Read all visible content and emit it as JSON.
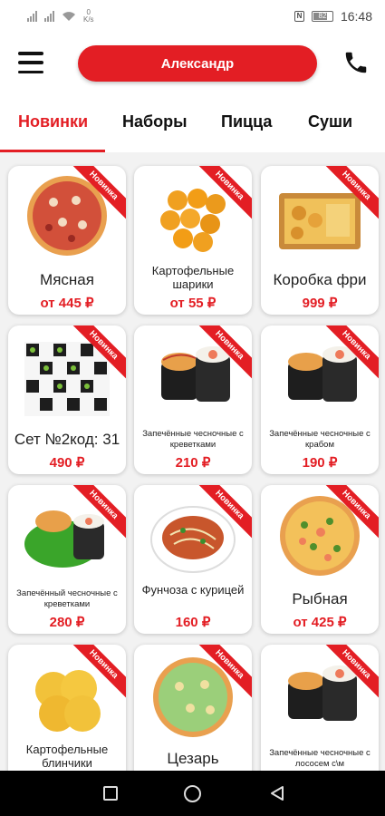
{
  "status_bar": {
    "network_speed": "0\nK/s",
    "time": "16:48",
    "battery": "82"
  },
  "header": {
    "user_name": "Александр"
  },
  "tabs": [
    {
      "label": "Новинки",
      "active": true
    },
    {
      "label": "Наборы",
      "active": false
    },
    {
      "label": "Пицца",
      "active": false
    },
    {
      "label": "Суши",
      "active": false
    }
  ],
  "badge_label": "Новинка",
  "products": [
    {
      "name": "Мясная",
      "price": "от 445 ₽",
      "image": "pizza-meat"
    },
    {
      "name": "Картофельные шарики",
      "price": "от 55 ₽",
      "image": "potato-balls"
    },
    {
      "name": "Коробка фри",
      "price": "999 ₽",
      "image": "fries-box"
    },
    {
      "name": "Сет №2код: 31",
      "price": "490 ₽",
      "image": "sushi-set"
    },
    {
      "name": "Запечённые чесночные с креветками",
      "price": "210 ₽",
      "image": "baked-rolls"
    },
    {
      "name": "Запечённые чесночные с крабом",
      "price": "190 ₽",
      "image": "baked-rolls"
    },
    {
      "name": "Запечённый чесночные с креветками",
      "price": "280 ₽",
      "image": "green-rolls"
    },
    {
      "name": "Фунчоза с курицей",
      "price": "160 ₽",
      "image": "funchoza"
    },
    {
      "name": "Рыбная",
      "price": "от 425 ₽",
      "image": "pizza-fish"
    },
    {
      "name": "Картофельные блинчики",
      "price": "",
      "image": "potato-pancakes"
    },
    {
      "name": "Цезарь",
      "price": "",
      "image": "pizza-caesar"
    },
    {
      "name": "Запечённые чесночные с лососем с\\м",
      "price": "",
      "image": "baked-rolls"
    }
  ],
  "colors": {
    "accent": "#e31e24",
    "background": "#f2f2f2"
  }
}
